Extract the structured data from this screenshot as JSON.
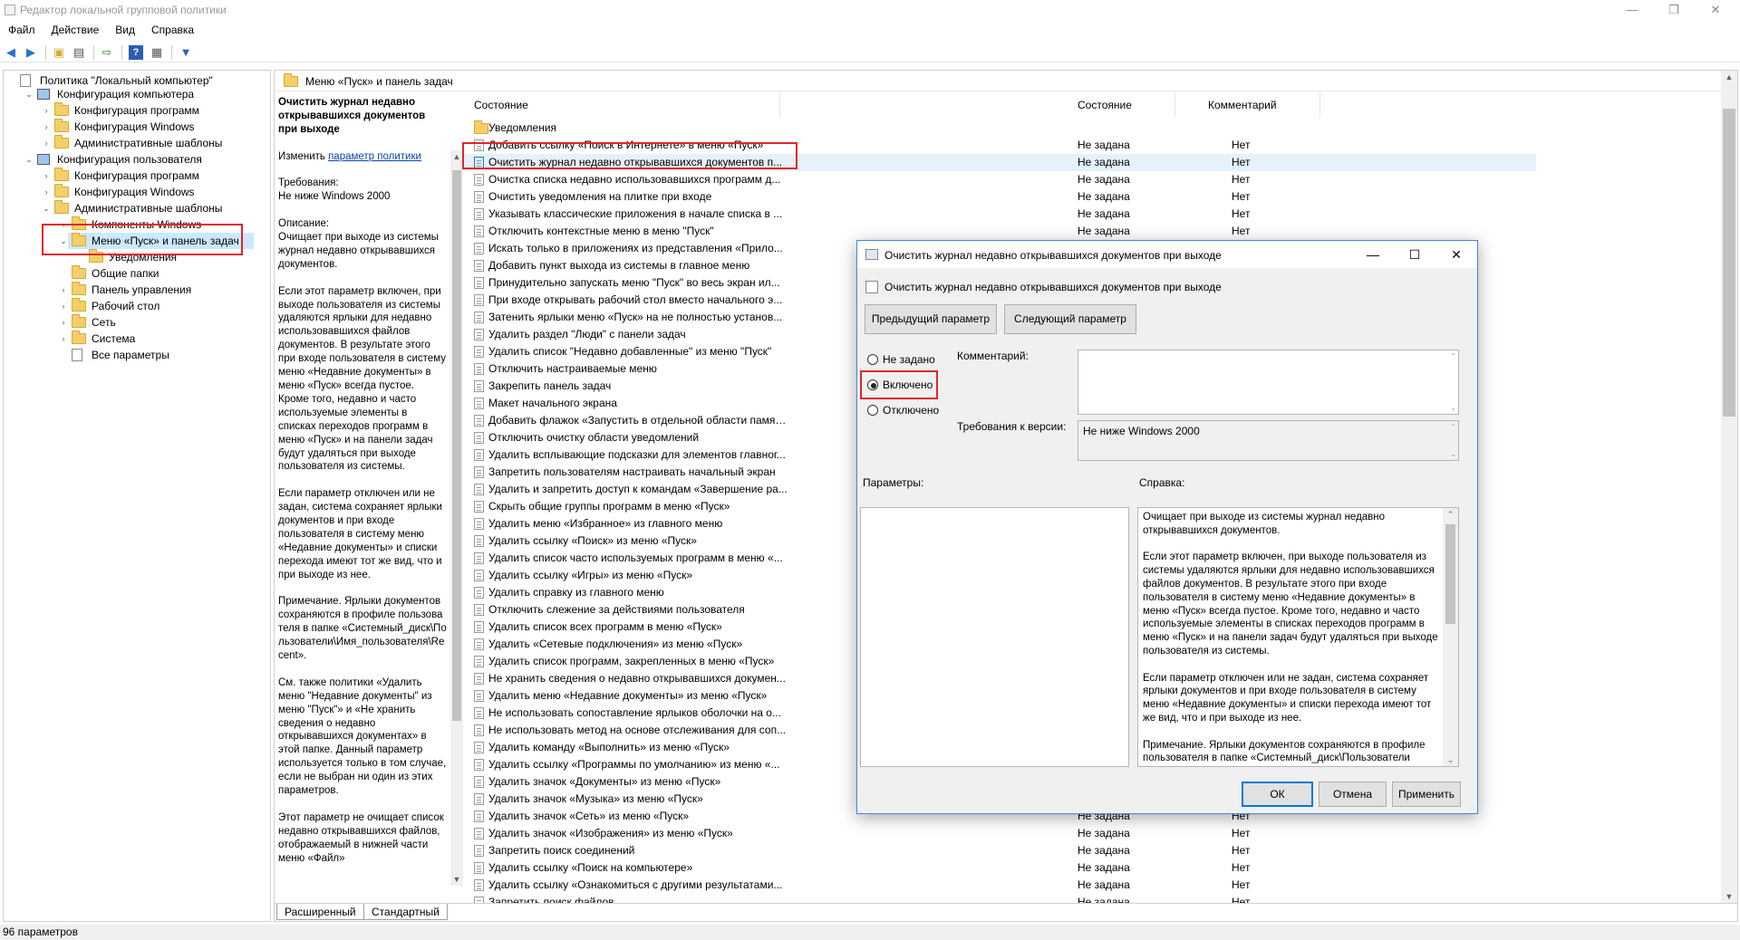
{
  "window": {
    "title": "Редактор локальной групповой политики",
    "controls": {
      "minimize": "—",
      "restore": "❐",
      "close": "✕"
    }
  },
  "menubar": [
    "Файл",
    "Действие",
    "Вид",
    "Справка"
  ],
  "toolbar_icons": [
    "back-icon",
    "forward-icon",
    "folder-up-icon",
    "show-tree-icon",
    "export-icon",
    "help-icon",
    "properties-icon",
    "filter-icon"
  ],
  "tree": {
    "items": [
      {
        "label": "Политика \"Локальный компьютер\"",
        "icon": "document-icon",
        "chevron": ""
      },
      {
        "label": "Конфигурация компьютера",
        "icon": "computer-icon",
        "chevron": "⌄"
      },
      {
        "label": "Конфигурация программ",
        "icon": "folder-icon",
        "chevron": "›"
      },
      {
        "label": "Конфигурация Windows",
        "icon": "folder-icon",
        "chevron": "›"
      },
      {
        "label": "Административные шаблоны",
        "icon": "folder-icon",
        "chevron": "›"
      },
      {
        "label": "Конфигурация пользователя",
        "icon": "user-icon",
        "chevron": "⌄"
      },
      {
        "label": "Конфигурация программ",
        "icon": "folder-icon",
        "chevron": "›"
      },
      {
        "label": "Конфигурация Windows",
        "icon": "folder-icon",
        "chevron": "›"
      },
      {
        "label": "Административные шаблоны",
        "icon": "folder-icon",
        "chevron": "⌄"
      },
      {
        "label": "Компоненты Windows",
        "icon": "folder-icon",
        "chevron": "›"
      },
      {
        "label": "Меню «Пуск» и панель задач",
        "icon": "folder-icon",
        "chevron": "⌄"
      },
      {
        "label": "Уведомления",
        "icon": "folder-icon",
        "chevron": ""
      },
      {
        "label": "Общие папки",
        "icon": "folder-icon",
        "chevron": ""
      },
      {
        "label": "Панель управления",
        "icon": "folder-icon",
        "chevron": "›"
      },
      {
        "label": "Рабочий стол",
        "icon": "folder-icon",
        "chevron": "›"
      },
      {
        "label": "Сеть",
        "icon": "folder-icon",
        "chevron": "›"
      },
      {
        "label": "Система",
        "icon": "folder-icon",
        "chevron": "›"
      },
      {
        "label": "Все параметры",
        "icon": "document-icon",
        "chevron": ""
      }
    ]
  },
  "main": {
    "header": "Меню «Пуск» и панель задач",
    "description": {
      "title": "Очистить журнал недавно открывавшихся документов при выходе",
      "edit_prefix": "Изменить",
      "edit_link": "параметр политики",
      "requirements_label": "Требования:",
      "requirements_value": "Не ниже Windows 2000",
      "description_label": "Описание:",
      "paragraphs": [
        "Очищает при выходе из системы журнал недавно открывавшихся документов.",
        "Если этот параметр включен, при выходе пользователя из системы удаляются ярлыки для недавно использовавшихся файлов документов. В результате этого при входе пользователя в систему меню «Недавние документы» в меню «Пуск» всегда пустое. Кроме того, недавно и часто используемые элементы в списках переходов программ в меню «Пуск» и на панели задач будут удаляться при выходе пользователя из системы.",
        "Если параметр отключен или не задан, система сохраняет ярлыки документов и при входе пользователя в систему меню «Недавние документы» и списки перехода имеют тот же вид, что и при выходе из нее.",
        "Примечание. Ярлыки документов сохраняются в профиле пользователя в папке «Системный_диск\\Пользователи\\Имя_пользователя\\Recent».",
        "См. также политики «Удалить меню \"Недавние документы\" из меню \"Пуск\"» и «Не хранить сведения о недавно открывавшихся документах» в этой папке. Данный параметр используется только в том случае, если не выбран ни один из этих параметров.",
        "Этот параметр не очищает список недавно открывавшихся файлов, отображаемый в нижней части меню «Файл»"
      ]
    },
    "columns": {
      "name": "Состояние",
      "state": "Состояние",
      "comment": "Комментарий"
    },
    "folder_row": "Уведомления",
    "rows": [
      {
        "name": "Добавить ссылку «Поиск в Интернете» в меню «Пуск»",
        "state": "Не задана",
        "comment": "Нет"
      },
      {
        "name": "Очистить журнал недавно открывавшихся документов п...",
        "state": "Не задана",
        "comment": "Нет"
      },
      {
        "name": "Очистка списка недавно использовавшихся программ д...",
        "state": "Не задана",
        "comment": "Нет"
      },
      {
        "name": "Очистить уведомления на плитке при входе",
        "state": "Не задана",
        "comment": "Нет"
      },
      {
        "name": "Указывать классические приложения в начале списка в ...",
        "state": "Не задана",
        "comment": "Нет"
      },
      {
        "name": "Отключить контекстные меню в меню \"Пуск\"",
        "state": "Не задана",
        "comment": "Нет"
      },
      {
        "name": "Искать только в приложениях из представления «Прило...",
        "state": "Не задана",
        "comment": "Нет"
      },
      {
        "name": "Добавить пункт выхода из системы в главное меню",
        "state": "Не задана",
        "comment": "Нет"
      },
      {
        "name": "Принудительно запускать меню \"Пуск\" во весь экран ил...",
        "state": "Не задана",
        "comment": "Нет"
      },
      {
        "name": "При входе открывать рабочий стол вместо начального э...",
        "state": "Не задана",
        "comment": "Нет"
      },
      {
        "name": "Затенить ярлыки меню «Пуск» на не полностью установ...",
        "state": "Не задана",
        "comment": "Нет"
      },
      {
        "name": "Удалить раздел \"Люди\" с панели задач",
        "state": "Не задана",
        "comment": "Нет"
      },
      {
        "name": "Удалить список \"Недавно добавленные\" из меню \"Пуск\"",
        "state": "Не задана",
        "comment": "Нет"
      },
      {
        "name": "Отключить настраиваемые меню",
        "state": "Не задана",
        "comment": "Нет"
      },
      {
        "name": "Закрепить панель задач",
        "state": "Не задана",
        "comment": "Нет"
      },
      {
        "name": "Макет начального экрана",
        "state": "Не задана",
        "comment": "Нет"
      },
      {
        "name": "Добавить флажок «Запустить в отдельной области памят...",
        "state": "Не задана",
        "comment": "Нет"
      },
      {
        "name": "Отключить очистку области уведомлений",
        "state": "Не задана",
        "comment": "Нет"
      },
      {
        "name": "Удалить всплывающие подсказки для элементов главног...",
        "state": "Не задана",
        "comment": "Нет"
      },
      {
        "name": "Запретить пользователям настраивать начальный экран",
        "state": "Не задана",
        "comment": "Нет"
      },
      {
        "name": "Удалить и запретить доступ к командам «Завершение ра...",
        "state": "Не задана",
        "comment": "Нет"
      },
      {
        "name": "Скрыть общие группы программ в меню «Пуск»",
        "state": "Не задана",
        "comment": "Нет"
      },
      {
        "name": "Удалить меню «Избранное» из главного меню",
        "state": "Не задана",
        "comment": "Нет"
      },
      {
        "name": "Удалить ссылку «Поиск» из меню «Пуск»",
        "state": "Не задана",
        "comment": "Нет"
      },
      {
        "name": "Удалить список часто используемых программ в меню «...",
        "state": "Не задана",
        "comment": "Нет"
      },
      {
        "name": "Удалить ссылку «Игры» из меню «Пуск»",
        "state": "Не задана",
        "comment": "Нет"
      },
      {
        "name": "Удалить справку из главного меню",
        "state": "Не задана",
        "comment": "Нет"
      },
      {
        "name": "Отключить слежение за действиями пользователя",
        "state": "Не задана",
        "comment": "Нет"
      },
      {
        "name": "Удалить список всех программ в меню «Пуск»",
        "state": "Не задана",
        "comment": "Нет"
      },
      {
        "name": "Удалить «Сетевые подключения» из меню «Пуск»",
        "state": "Не задана",
        "comment": "Нет"
      },
      {
        "name": "Удалить список программ, закрепленных в меню «Пуск»",
        "state": "Не задана",
        "comment": "Нет"
      },
      {
        "name": "Не хранить сведения о недавно открывавшихся докумен...",
        "state": "Не задана",
        "comment": "Нет"
      },
      {
        "name": "Удалить меню «Недавние документы» из меню «Пуск»",
        "state": "Не задана",
        "comment": "Нет"
      },
      {
        "name": "Не использовать сопоставление ярлыков оболочки на о...",
        "state": "Не задана",
        "comment": "Нет"
      },
      {
        "name": "Не использовать метод на основе отслеживания для соп...",
        "state": "Не задана",
        "comment": "Нет"
      },
      {
        "name": "Удалить команду «Выполнить» из меню «Пуск»",
        "state": "Не задана",
        "comment": "Нет"
      },
      {
        "name": "Удалить ссылку «Программы по умолчанию» из меню «...",
        "state": "Не задана",
        "comment": "Нет"
      },
      {
        "name": "Удалить значок «Документы» из меню «Пуск»",
        "state": "Не задана",
        "comment": "Нет"
      },
      {
        "name": "Удалить значок «Музыка» из меню «Пуск»",
        "state": "Не задана",
        "comment": "Нет"
      },
      {
        "name": "Удалить значок «Сеть» из меню «Пуск»",
        "state": "Не задана",
        "comment": "Нет"
      },
      {
        "name": "Удалить значок «Изображения» из меню «Пуск»",
        "state": "Не задана",
        "comment": "Нет"
      },
      {
        "name": "Запретить поиск соединений",
        "state": "Не задана",
        "comment": "Нет"
      },
      {
        "name": "Удалить ссылку «Поиск на компьютере»",
        "state": "Не задана",
        "comment": "Нет"
      },
      {
        "name": "Удалить ссылку «Ознакомиться с другими результатами...",
        "state": "Не задана",
        "comment": "Нет"
      },
      {
        "name": "Запретить поиск файлов",
        "state": "Не задана",
        "comment": "Нет"
      }
    ],
    "tabs": [
      "Расширенный",
      "Стандартный"
    ]
  },
  "status": "96 параметров",
  "dialog": {
    "title": "Очистить журнал недавно открывавшихся документов при выходе",
    "subtitle": "Очистить журнал недавно открывавшихся документов при выходе",
    "prev_button": "Предыдущий параметр",
    "next_button": "Следующий параметр",
    "radio_not_configured": "Не задано",
    "radio_enabled": "Включено",
    "radio_disabled": "Отключено",
    "selected": "Включено",
    "comment_label": "Комментарий:",
    "comment_value": "",
    "supported_label": "Требования к версии:",
    "supported_value": "Не ниже Windows 2000",
    "options_label": "Параметры:",
    "help_label": "Справка:",
    "help_paragraphs": [
      "Очищает при выходе из системы журнал недавно открывавшихся документов.",
      "Если этот параметр включен, при выходе пользователя из системы удаляются ярлыки для недавно использовавшихся файлов документов. В результате этого при входе пользователя в систему меню «Недавние документы» в меню «Пуск» всегда пустое. Кроме того, недавно и часто используемые элементы в списках переходов программ в меню «Пуск» и на панели задач будут удаляться при выходе пользователя из системы.",
      "Если параметр отключен или не задан, система сохраняет ярлыки документов и при входе пользователя в систему меню «Недавние документы» и списки перехода имеют тот же вид, что и при выходе из нее.",
      "Примечание. Ярлыки документов сохраняются в профиле пользователя в папке «Системный_диск\\Пользователи"
    ],
    "ok": "ОК",
    "cancel": "Отмена",
    "apply": "Применить"
  },
  "colors": {
    "highlight_red": "#e0262b",
    "selection": "#e5f1fb",
    "accent": "#0078d7"
  }
}
